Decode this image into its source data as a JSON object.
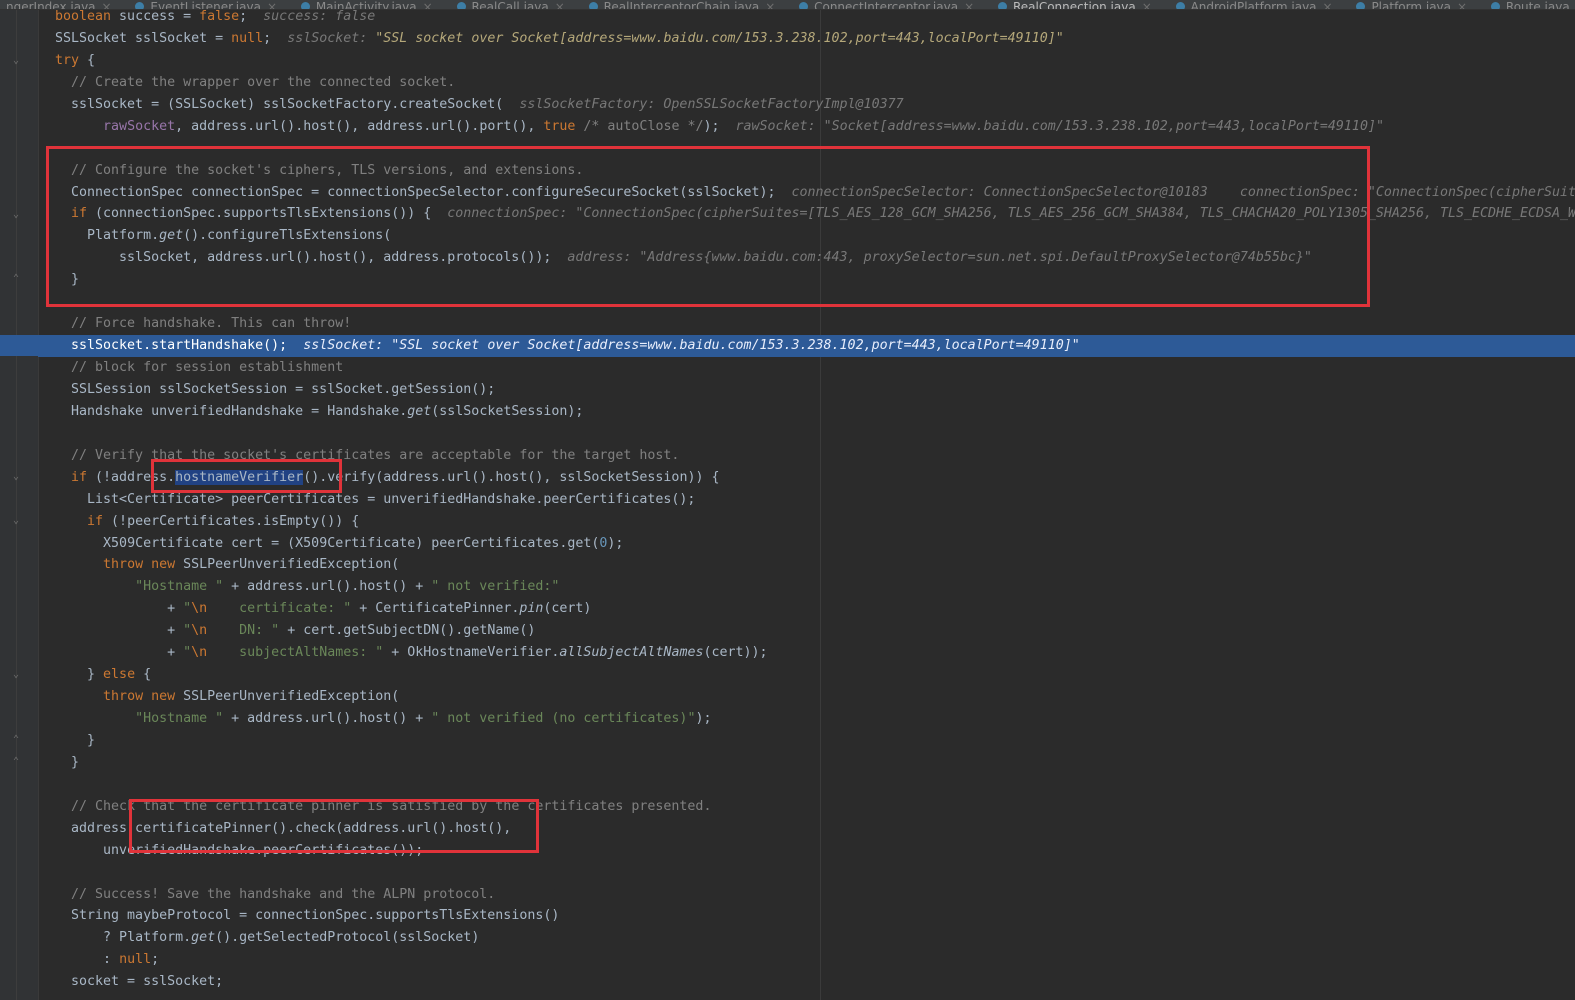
{
  "tabs": [
    {
      "label": "ngerIndex.java",
      "active": false
    },
    {
      "label": "EventListener.java",
      "active": false
    },
    {
      "label": "MainActivity.java",
      "active": false
    },
    {
      "label": "RealCall.java",
      "active": false
    },
    {
      "label": "RealInterceptorChain.java",
      "active": false
    },
    {
      "label": "ConnectInterceptor.java",
      "active": false
    },
    {
      "label": "RealConnection.java",
      "active": true
    },
    {
      "label": "AndroidPlatform.java",
      "active": false
    },
    {
      "label": "Platform.java",
      "active": false
    },
    {
      "label": "Route.java",
      "active": false
    }
  ],
  "colors": {
    "background": "#2b2b2b",
    "keyword": "#cc7832",
    "comment": "#808080",
    "string": "#6a8759",
    "number": "#6897bb",
    "execution_line": "#2d5a97",
    "highlight_box": "#e0333a"
  },
  "icons": {
    "fold_marker": "fold-marker-icon",
    "tab_file": "java-class-icon"
  },
  "code": {
    "l1": {
      "kw": "boolean",
      "t1": " success = ",
      "kw2": "false",
      "t2": ";",
      "hint": "success: false"
    },
    "l2": {
      "t1": "SSLSocket sslSocket = ",
      "kw": "null",
      "t2": ";",
      "hint_label": "sslSocket: ",
      "hint_value": "\"SSL socket over Socket[address=www.baidu.com/153.3.238.102,port=443,localPort=49110]\""
    },
    "l3": {
      "kw": "try",
      "t1": " {"
    },
    "l4": {
      "cm": "// Create the wrapper over the connected socket."
    },
    "l5": {
      "t1": "sslSocket = (SSLSocket) sslSocketFactory.createSocket(",
      "hint": "sslSocketFactory: OpenSSLSocketFactoryImpl@10377"
    },
    "l6": {
      "t1": "rawSocket",
      "t2": ", address.url().host(), address.url().port(), ",
      "kw": "true",
      "cm": " /* autoClose */",
      "t3": ");",
      "hint_label": "rawSocket: ",
      "hint_value": "\"Socket[address=www.baidu.com/153.3.238.102,port=443,localPort=49110]\""
    },
    "l8": {
      "cm": "// Configure the socket's ciphers, TLS versions, and extensions."
    },
    "l9": {
      "t1": "ConnectionSpec connectionSpec = connectionSpecSelector.configureSecureSocket(sslSocket);",
      "hint1": "connectionSpecSelector: ConnectionSpecSelector@10183",
      "hint2": "connectionSpec: \"ConnectionSpec(cipherSuit"
    },
    "l10": {
      "kw": "if",
      "t1": " (connectionSpec.supportsTlsExtensions()) {",
      "hint_label": "connectionSpec: ",
      "hint_value": "\"ConnectionSpec(cipherSuites=[TLS_AES_128_GCM_SHA256, TLS_AES_256_GCM_SHA384, TLS_CHACHA20_POLY1305_SHA256, TLS_ECDHE_ECDSA_W"
    },
    "l11": {
      "t1": "Platform.",
      "t2": "get",
      "t3": "().configureTlsExtensions("
    },
    "l12": {
      "t1": "sslSocket, address.url().host(), address.protocols());",
      "hint_label": "address: ",
      "hint_value": "\"Address{www.baidu.com:443, proxySelector=sun.net.spi.DefaultProxySelector@74b55bc}\""
    },
    "l13": {
      "t1": "}"
    },
    "l15": {
      "cm": "// Force handshake. This can throw!"
    },
    "l16": {
      "t1": "sslSocket.startHandshake();",
      "hint_label": "sslSocket: ",
      "hint_value": "\"SSL socket over Socket[address=www.baidu.com/153.3.238.102,port=443,localPort=49110]\""
    },
    "l17": {
      "cm": "// block for session establishment"
    },
    "l18": {
      "t1": "SSLSession sslSocketSession = sslSocket.getSession();"
    },
    "l19": {
      "t1": "Handshake unverifiedHandshake = Handshake.",
      "t2": "get",
      "t3": "(sslSocketSession);"
    },
    "l21": {
      "cm": "// Verify that the socket's certificates are acceptable for the target host."
    },
    "l22": {
      "kw": "if",
      "t1": " (!address.",
      "sel": "hostnameVerifier",
      "t2": "().verify(address.url().host(), sslSocketSession)) {"
    },
    "l23": {
      "t1": "List<Certificate> peerCertificates = unverifiedHandshake.peerCertificates();"
    },
    "l24": {
      "kw": "if",
      "t1": " (!peerCertificates.isEmpty()) {"
    },
    "l25": {
      "t1": "X509Certificate cert = (X509Certificate) peerCertificates.get(",
      "num": "0",
      "t2": ");"
    },
    "l26": {
      "kw": "throw new",
      "t1": " SSLPeerUnverifiedException("
    },
    "l27": {
      "s1": "\"Hostname \"",
      "t1": " + address.url().host() + ",
      "s2": "\" not verified:\""
    },
    "l28": {
      "t1": "+ ",
      "s1": "\"",
      "esc": "\\n",
      "s2": "    certificate: \"",
      "t2": " + CertificatePinner.",
      "t3": "pin",
      "t4": "(cert)"
    },
    "l29": {
      "t1": "+ ",
      "s1": "\"",
      "esc": "\\n",
      "s2": "    DN: \"",
      "t2": " + cert.getSubjectDN().getName()"
    },
    "l30": {
      "t1": "+ ",
      "s1": "\"",
      "esc": "\\n",
      "s2": "    subjectAltNames: \"",
      "t2": " + OkHostnameVerifier.",
      "t3": "allSubjectAltNames",
      "t4": "(cert));"
    },
    "l31": {
      "t1": "} ",
      "kw": "else",
      "t2": " {"
    },
    "l32": {
      "kw": "throw new",
      "t1": " SSLPeerUnverifiedException("
    },
    "l33": {
      "s1": "\"Hostname \"",
      "t1": " + address.url().host() + ",
      "s2": "\" not verified (no certificates)\"",
      "t2": ");"
    },
    "l34": {
      "t1": "}"
    },
    "l35": {
      "t1": "}"
    },
    "l37": {
      "cm": "// Check that the certificate pinner is satisfied by the certificates presented."
    },
    "l38": {
      "t1": "address.certificatePinner().check(address.url().host(),"
    },
    "l39": {
      "t1": "unverifiedHandshake.peerCertificates());"
    },
    "l41": {
      "cm": "// Success! Save the handshake and the ALPN protocol."
    },
    "l42": {
      "t1": "String maybeProtocol = connectionSpec.supportsTlsExtensions()"
    },
    "l43": {
      "t1": "? Platform.",
      "t2": "get",
      "t3": "().getSelectedProtocol(sslSocket)"
    },
    "l44": {
      "t1": ": ",
      "kw": "null",
      "t2": ";"
    },
    "l45": {
      "t1": "socket = sslSocket;"
    }
  }
}
